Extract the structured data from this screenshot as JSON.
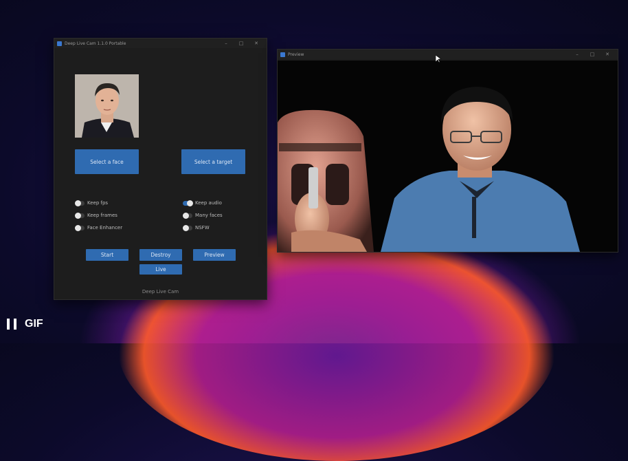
{
  "main_window": {
    "title": "Deep Live Cam 1.1.0 Portable",
    "select_face_label": "Select a face",
    "select_target_label": "Select a target",
    "options_left": [
      {
        "label": "Keep fps",
        "on": false
      },
      {
        "label": "Keep frames",
        "on": false
      },
      {
        "label": "Face Enhancer",
        "on": false
      }
    ],
    "options_right": [
      {
        "label": "Keep audio",
        "on": true
      },
      {
        "label": "Many faces",
        "on": false
      },
      {
        "label": "NSFW",
        "on": false
      }
    ],
    "start_label": "Start",
    "destroy_label": "Destroy",
    "preview_label": "Preview",
    "live_label": "Live",
    "footer": "Deep Live Cam"
  },
  "preview_window": {
    "title": "Preview"
  },
  "overlay": {
    "gif_label": "GIF"
  },
  "colors": {
    "accent": "#2f6bb1",
    "window_bg": "#1d1d1d"
  }
}
